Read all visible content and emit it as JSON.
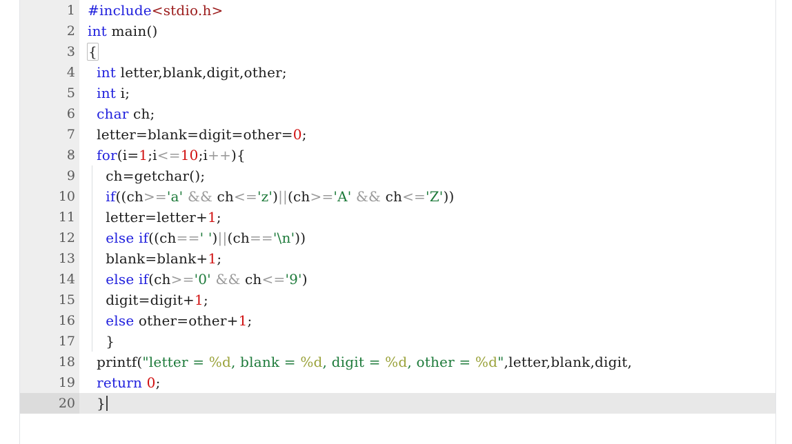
{
  "editor": {
    "language": "C",
    "active_line": 20,
    "total_lines": 20,
    "colors": {
      "background": "#ffffff",
      "gutter_background": "#eeeeee",
      "active_line_background": "#e8e8e8",
      "active_gutter_background": "#dcdcdc",
      "keyword": "#2020dd",
      "number": "#d01010",
      "string": "#1d7a3a",
      "char_literal": "#1d7a3a",
      "format_specifier": "#9aa23a",
      "include_path": "#9b1b1b",
      "operator": "#9a9a9a",
      "plain_text": "#1c1c1c",
      "indent_guide": "#dadde0"
    },
    "fold_marker": "▾",
    "fold_lines": [
      3,
      8
    ]
  },
  "lines": [
    {
      "number": "1",
      "fold": "",
      "indent_guides": 0,
      "tokens": [
        {
          "t": "#include",
          "c": "kw"
        },
        {
          "t": "<stdio.h>",
          "c": "inc"
        }
      ]
    },
    {
      "number": "2",
      "fold": "",
      "indent_guides": 0,
      "tokens": [
        {
          "t": "int",
          "c": "kw"
        },
        {
          "t": " main()",
          "c": "pl"
        }
      ]
    },
    {
      "number": "3",
      "fold": "▾",
      "indent_guides": 0,
      "tokens": [
        {
          "t": "{",
          "c": "brace"
        }
      ]
    },
    {
      "number": "4",
      "fold": "",
      "indent_guides": 0,
      "tokens": [
        {
          "t": "  ",
          "c": "pl"
        },
        {
          "t": "int",
          "c": "kw"
        },
        {
          "t": " letter,blank,digit,other;",
          "c": "pl"
        }
      ]
    },
    {
      "number": "5",
      "fold": "",
      "indent_guides": 0,
      "tokens": [
        {
          "t": "  ",
          "c": "pl"
        },
        {
          "t": "int",
          "c": "kw"
        },
        {
          "t": " i;",
          "c": "pl"
        }
      ]
    },
    {
      "number": "6",
      "fold": "",
      "indent_guides": 0,
      "tokens": [
        {
          "t": "  ",
          "c": "pl"
        },
        {
          "t": "char",
          "c": "kw"
        },
        {
          "t": " ch;",
          "c": "pl"
        }
      ]
    },
    {
      "number": "7",
      "fold": "",
      "indent_guides": 0,
      "tokens": [
        {
          "t": "  letter=blank=digit=other=",
          "c": "pl"
        },
        {
          "t": "0",
          "c": "num"
        },
        {
          "t": ";",
          "c": "pl"
        }
      ]
    },
    {
      "number": "8",
      "fold": "▾",
      "indent_guides": 0,
      "tokens": [
        {
          "t": "  ",
          "c": "pl"
        },
        {
          "t": "for",
          "c": "kw"
        },
        {
          "t": "(i=",
          "c": "pl"
        },
        {
          "t": "1",
          "c": "num"
        },
        {
          "t": ";i",
          "c": "pl"
        },
        {
          "t": "<=",
          "c": "op"
        },
        {
          "t": "10",
          "c": "num"
        },
        {
          "t": ";i",
          "c": "pl"
        },
        {
          "t": "++",
          "c": "op"
        },
        {
          "t": "){",
          "c": "pl"
        }
      ]
    },
    {
      "number": "9",
      "fold": "",
      "indent_guides": 1,
      "tokens": [
        {
          "t": "    ch=getchar();",
          "c": "pl"
        }
      ]
    },
    {
      "number": "10",
      "fold": "",
      "indent_guides": 1,
      "tokens": [
        {
          "t": "    ",
          "c": "pl"
        },
        {
          "t": "if",
          "c": "kw"
        },
        {
          "t": "((ch",
          "c": "pl"
        },
        {
          "t": ">=",
          "c": "op"
        },
        {
          "t": "'a'",
          "c": "chr"
        },
        {
          "t": " ",
          "c": "pl"
        },
        {
          "t": "&&",
          "c": "op"
        },
        {
          "t": " ch",
          "c": "pl"
        },
        {
          "t": "<=",
          "c": "op"
        },
        {
          "t": "'z'",
          "c": "chr"
        },
        {
          "t": ")",
          "c": "pl"
        },
        {
          "t": "||",
          "c": "op"
        },
        {
          "t": "(ch",
          "c": "pl"
        },
        {
          "t": ">=",
          "c": "op"
        },
        {
          "t": "'A'",
          "c": "chr"
        },
        {
          "t": " ",
          "c": "pl"
        },
        {
          "t": "&&",
          "c": "op"
        },
        {
          "t": " ch",
          "c": "pl"
        },
        {
          "t": "<=",
          "c": "op"
        },
        {
          "t": "'Z'",
          "c": "chr"
        },
        {
          "t": "))",
          "c": "pl"
        }
      ]
    },
    {
      "number": "11",
      "fold": "",
      "indent_guides": 1,
      "tokens": [
        {
          "t": "    letter=letter+",
          "c": "pl"
        },
        {
          "t": "1",
          "c": "num"
        },
        {
          "t": ";",
          "c": "pl"
        }
      ]
    },
    {
      "number": "12",
      "fold": "",
      "indent_guides": 1,
      "tokens": [
        {
          "t": "    ",
          "c": "pl"
        },
        {
          "t": "else",
          "c": "kw"
        },
        {
          "t": " ",
          "c": "pl"
        },
        {
          "t": "if",
          "c": "kw"
        },
        {
          "t": "((ch",
          "c": "pl"
        },
        {
          "t": "==",
          "c": "op"
        },
        {
          "t": "' '",
          "c": "chr"
        },
        {
          "t": ")",
          "c": "pl"
        },
        {
          "t": "||",
          "c": "op"
        },
        {
          "t": "(ch",
          "c": "pl"
        },
        {
          "t": "==",
          "c": "op"
        },
        {
          "t": "'\\n'",
          "c": "chr"
        },
        {
          "t": "))",
          "c": "pl"
        }
      ]
    },
    {
      "number": "13",
      "fold": "",
      "indent_guides": 1,
      "tokens": [
        {
          "t": "    blank=blank+",
          "c": "pl"
        },
        {
          "t": "1",
          "c": "num"
        },
        {
          "t": ";",
          "c": "pl"
        }
      ]
    },
    {
      "number": "14",
      "fold": "",
      "indent_guides": 1,
      "tokens": [
        {
          "t": "    ",
          "c": "pl"
        },
        {
          "t": "else",
          "c": "kw"
        },
        {
          "t": " ",
          "c": "pl"
        },
        {
          "t": "if",
          "c": "kw"
        },
        {
          "t": "(ch",
          "c": "pl"
        },
        {
          "t": ">=",
          "c": "op"
        },
        {
          "t": "'0'",
          "c": "chr"
        },
        {
          "t": " ",
          "c": "pl"
        },
        {
          "t": "&&",
          "c": "op"
        },
        {
          "t": " ch",
          "c": "pl"
        },
        {
          "t": "<=",
          "c": "op"
        },
        {
          "t": "'9'",
          "c": "chr"
        },
        {
          "t": ")",
          "c": "pl"
        }
      ]
    },
    {
      "number": "15",
      "fold": "",
      "indent_guides": 1,
      "tokens": [
        {
          "t": "    digit=digit+",
          "c": "pl"
        },
        {
          "t": "1",
          "c": "num"
        },
        {
          "t": ";",
          "c": "pl"
        }
      ]
    },
    {
      "number": "16",
      "fold": "",
      "indent_guides": 1,
      "tokens": [
        {
          "t": "    ",
          "c": "pl"
        },
        {
          "t": "else",
          "c": "kw"
        },
        {
          "t": " other=other+",
          "c": "pl"
        },
        {
          "t": "1",
          "c": "num"
        },
        {
          "t": ";",
          "c": "pl"
        }
      ]
    },
    {
      "number": "17",
      "fold": "",
      "indent_guides": 1,
      "tokens": [
        {
          "t": "    }",
          "c": "pl"
        }
      ]
    },
    {
      "number": "18",
      "fold": "",
      "indent_guides": 0,
      "tokens": [
        {
          "t": "  printf(",
          "c": "pl"
        },
        {
          "t": "\"letter = ",
          "c": "str"
        },
        {
          "t": "%d",
          "c": "fmt"
        },
        {
          "t": ", blank = ",
          "c": "str"
        },
        {
          "t": "%d",
          "c": "fmt"
        },
        {
          "t": ", digit = ",
          "c": "str"
        },
        {
          "t": "%d",
          "c": "fmt"
        },
        {
          "t": ", other = ",
          "c": "str"
        },
        {
          "t": "%d",
          "c": "fmt"
        },
        {
          "t": "\"",
          "c": "str"
        },
        {
          "t": ",letter,blank,digit,",
          "c": "pl"
        }
      ]
    },
    {
      "number": "19",
      "fold": "",
      "indent_guides": 0,
      "tokens": [
        {
          "t": "  ",
          "c": "pl"
        },
        {
          "t": "return",
          "c": "kw"
        },
        {
          "t": " ",
          "c": "pl"
        },
        {
          "t": "0",
          "c": "num"
        },
        {
          "t": ";",
          "c": "pl"
        }
      ]
    },
    {
      "number": "20",
      "fold": "",
      "indent_guides": 0,
      "active": true,
      "caret": true,
      "tokens": [
        {
          "t": "  }",
          "c": "pl"
        }
      ]
    }
  ]
}
